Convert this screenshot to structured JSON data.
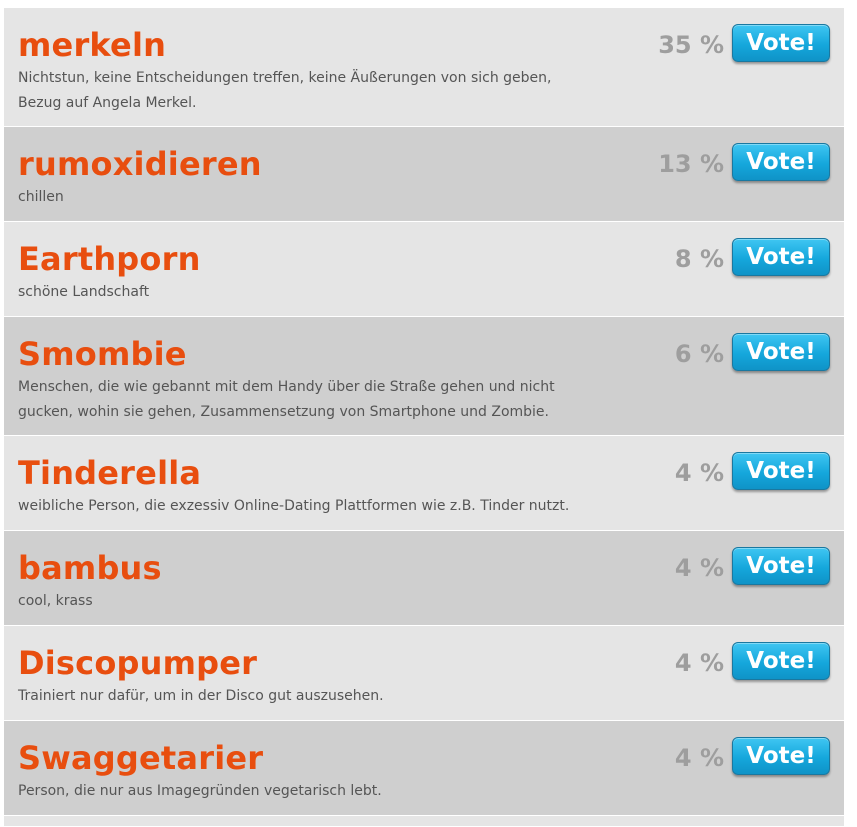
{
  "items": [
    {
      "word": "merkeln",
      "description": "Nichtstun, keine Entscheidungen treffen, keine Äußerungen von sich geben, Bezug auf Angela Merkel.",
      "percent": "35 %",
      "vote_label": "Vote!"
    },
    {
      "word": "rumoxidieren",
      "description": "chillen",
      "percent": "13 %",
      "vote_label": "Vote!"
    },
    {
      "word": "Earthporn",
      "description": "schöne Landschaft",
      "percent": "8 %",
      "vote_label": "Vote!"
    },
    {
      "word": "Smombie",
      "description": "Menschen, die wie gebannt mit dem Handy über die Straße gehen und nicht gucken, wohin sie gehen, Zusammensetzung von Smartphone und Zombie.",
      "percent": "6 %",
      "vote_label": "Vote!"
    },
    {
      "word": "Tinderella",
      "description": "weibliche Person, die exzessiv Online-Dating Plattformen wie z.B. Tinder nutzt.",
      "percent": "4 %",
      "vote_label": "Vote!"
    },
    {
      "word": "bambus",
      "description": "cool, krass",
      "percent": "4 %",
      "vote_label": "Vote!"
    },
    {
      "word": "Discopumper",
      "description": "Trainiert nur dafür, um in der Disco gut auszusehen.",
      "percent": "4 %",
      "vote_label": "Vote!"
    },
    {
      "word": "Swaggetarier",
      "description": "Person, die nur aus Imagegründen vegetarisch lebt.",
      "percent": "4 %",
      "vote_label": "Vote!"
    }
  ],
  "colors": {
    "word": "#e84e0f",
    "percent": "#9e9e9e",
    "description": "#555555",
    "row_light": "#e5e5e5",
    "row_dark": "#cfcfcf",
    "button": "#15a7dc",
    "button_text": "#ffffff"
  }
}
